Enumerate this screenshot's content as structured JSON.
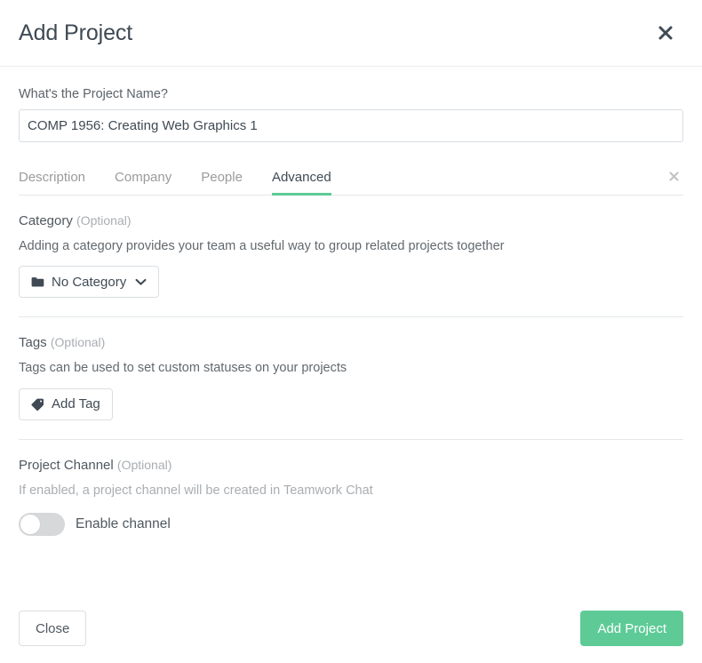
{
  "header": {
    "title": "Add Project",
    "close_icon": "close-icon"
  },
  "project_name": {
    "label": "What's the Project Name?",
    "value": "COMP 1956: Creating Web Graphics 1",
    "placeholder": "Project name"
  },
  "tabs": {
    "items": [
      {
        "label": "Description",
        "active": false
      },
      {
        "label": "Company",
        "active": false
      },
      {
        "label": "People",
        "active": false
      },
      {
        "label": "Advanced",
        "active": true
      }
    ],
    "close_icon": "close-icon"
  },
  "category": {
    "title": "Category",
    "optional": "(Optional)",
    "description": "Adding a category provides your team a useful way to group related projects together",
    "selected": "No Category",
    "folder_icon": "folder-icon",
    "chevron_icon": "chevron-down-icon"
  },
  "tags": {
    "title": "Tags",
    "optional": "(Optional)",
    "description": "Tags can be used to set custom statuses on your projects",
    "add_label": "Add Tag",
    "tag_icon": "tag-icon"
  },
  "project_channel": {
    "title": "Project Channel",
    "optional": "(Optional)",
    "description": "If enabled, a project channel will be created in Teamwork Chat",
    "toggle_label": "Enable channel",
    "toggle_enabled": false
  },
  "footer": {
    "close_label": "Close",
    "submit_label": "Add Project"
  },
  "colors": {
    "accent_green": "#5ecb97",
    "title_dark": "#3f4a54",
    "muted_gray": "#a9aeb2",
    "border": "#e4e7e9"
  }
}
